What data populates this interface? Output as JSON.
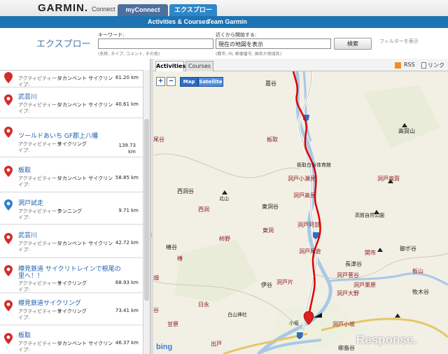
{
  "header": {
    "logo": "GARMIN.",
    "logo_sub": "Connect",
    "tabs": [
      "myConnect",
      "エクスプロー"
    ],
    "subnav": [
      "Activities & Courses",
      "Team Garmin"
    ]
  },
  "search": {
    "page_title": "エクスプロー",
    "keyword_label": "キーワード:",
    "keyword_value": "",
    "keyword_hint": "(名称, タイプ, コメント, その他)",
    "near_label": "近くから開始する:",
    "near_value": "現在の地図を表示",
    "near_hint": "(都市, 州, 郵便番号, 国名か地域名)",
    "search_button": "検索",
    "filter_link": "フィルターを表示"
  },
  "map_tabs": {
    "activities": "Activities",
    "courses": "Courses",
    "rss": "RSS",
    "link": "リンク"
  },
  "map": {
    "zoom_in": "+",
    "zoom_out": "−",
    "map_button": "Map",
    "satellite_button": "Satellite",
    "bing": "bing",
    "watermark": "Response.",
    "labels": [
      "葛谷",
      "板取",
      "板取白谷体育館",
      "洞戸小瀬見",
      "洞戸高見",
      "洞戸高賀",
      "高賀山",
      "洞戸阿部",
      "高賀自然公園",
      "東洞谷",
      "北山",
      "西洞谷",
      "洞戸",
      "東洞",
      "柿野",
      "椿谷",
      "洞戸尾倉",
      "関市",
      "御ボ谷",
      "板山",
      "洞戸菅谷",
      "洞戸栗原",
      "洞戸大野",
      "洞戸小坂",
      "長津谷",
      "伊谷",
      "洞戸片",
      "白山神社",
      "日永",
      "出戸",
      "柳島谷",
      "牧木谷",
      "尾谷",
      "小坂",
      "甘原",
      "畑"
    ]
  },
  "list": {
    "items": [
      {
        "name": "",
        "type": "アクティビティータ",
        "category": "リカンベント サイクリン",
        "distance": "61.20 km",
        "i": "イプ:",
        "color": "#d42b2b"
      },
      {
        "name": "武芸川",
        "type": "アクティビティータ",
        "category": "リカンベント サイクリン",
        "distance": "40.61 km",
        "i": "イプ:",
        "color": "#d42b2b"
      },
      {
        "name": "ツールドあいち GF郡上八幡",
        "type": "アクティビティータ",
        "category": "サイクリング",
        "distance": "139.73",
        "distance2": "km",
        "i": "イプ:",
        "color": "#d42b2b"
      },
      {
        "name": "板取",
        "type": "アクティビティータ",
        "category": "リカンベント サイクリン",
        "distance": "58.85 km",
        "i": "イプ:",
        "color": "#d42b2b"
      },
      {
        "name": "洞戸試走",
        "type": "アクティビティータ",
        "category": "ランニング",
        "distance": "9.71 km",
        "i": "イプ:",
        "color": "#2b7fd4"
      },
      {
        "name": "武芸川",
        "type": "アクティビティータ",
        "category": "リカンベント サイクリン",
        "distance": "42.72 km",
        "i": "イプ:",
        "color": "#d42b2b"
      },
      {
        "name": "樽見鉄道 サイクリトレインで根尾の",
        "name2": "里へ！！",
        "type": "アクティビティータ",
        "category": "サイクリング",
        "distance": "68.93 km",
        "i": "イプ:",
        "color": "#d42b2b"
      },
      {
        "name": "樽見鉄道サイクリング",
        "type": "アクティビティータ",
        "category": "サイクリング",
        "distance": "73.41 km",
        "i": "イプ:",
        "color": "#d42b2b"
      },
      {
        "name": "板取",
        "type": "アクティビティータ",
        "category": "リカンベント サイクリン",
        "distance": "46.37 km",
        "i": "イプ:",
        "color": "#d42b2b"
      }
    ]
  },
  "colors": {
    "route": "#e00000",
    "accent": "#1d73b3",
    "link": "#1f5fae"
  }
}
